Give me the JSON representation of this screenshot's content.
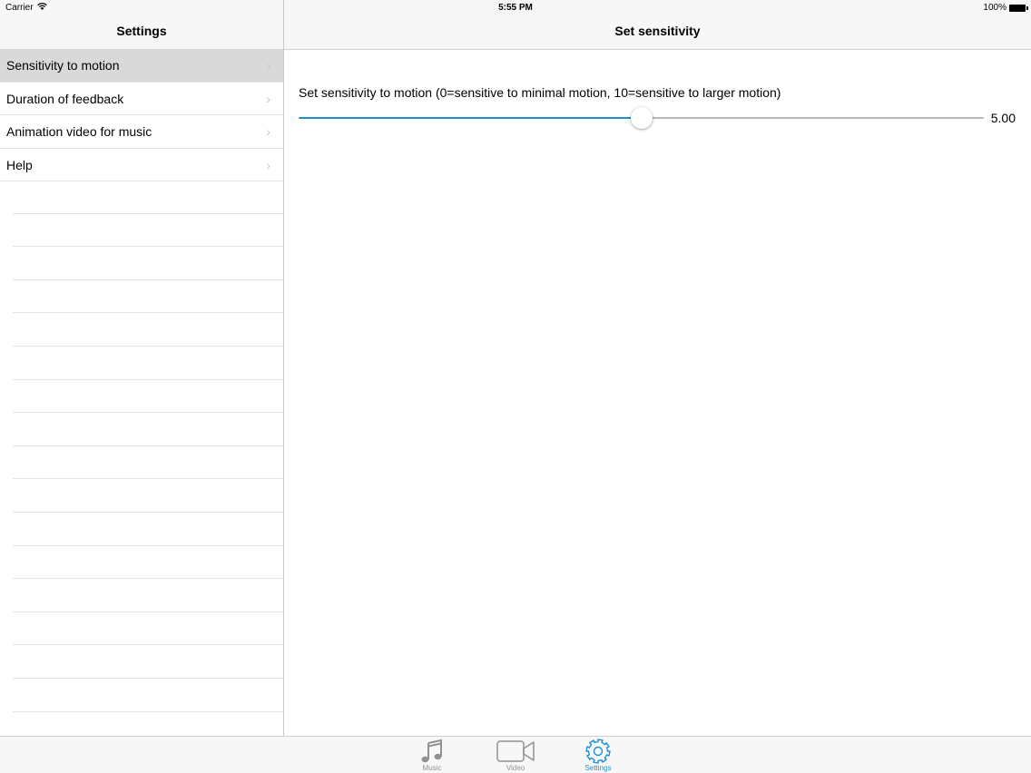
{
  "status_bar": {
    "carrier": "Carrier",
    "wifi_icon": "wifi-icon",
    "time": "5:55 PM",
    "battery_percent": "100%",
    "battery_icon": "battery-icon"
  },
  "master": {
    "title": "Settings",
    "items": [
      {
        "label": "Sensitivity to motion",
        "selected": true
      },
      {
        "label": "Duration of feedback",
        "selected": false
      },
      {
        "label": "Animation video for music",
        "selected": false
      },
      {
        "label": "Help",
        "selected": false
      }
    ],
    "chevron_icon": "chevron-right-icon"
  },
  "detail": {
    "title": "Set sensitivity",
    "label": "Set sensitivity to motion (0=sensitive to minimal motion, 10=sensitive to larger motion)",
    "slider": {
      "min": 0,
      "max": 10,
      "value": 5,
      "value_text": "5.00",
      "fill_color": "#1f8fc9",
      "track_color": "#b7b7b7"
    }
  },
  "tab_bar": {
    "active_color": "#1a8fd6",
    "inactive_color": "#929292",
    "tabs": [
      {
        "label": "Music",
        "icon": "music-note-icon",
        "active": false
      },
      {
        "label": "Video",
        "icon": "video-camera-icon",
        "active": false
      },
      {
        "label": "Settings",
        "icon": "gear-icon",
        "active": true
      }
    ]
  }
}
